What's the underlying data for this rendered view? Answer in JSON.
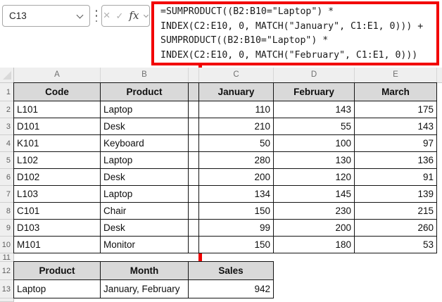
{
  "name_box": {
    "cell_ref": "C13"
  },
  "formula_bar": {
    "cancel_label": "×",
    "enter_label": "✓",
    "fx_label": "fx"
  },
  "formula_box": {
    "lines": [
      "=SUMPRODUCT((B2:B10=\"Laptop\") *",
      "INDEX(C2:E10, 0, MATCH(\"January\", C1:E1, 0))) +",
      "SUMPRODUCT((B2:B10=\"Laptop\") *",
      "INDEX(C2:E10, 0, MATCH(\"February\", C1:E1, 0)))"
    ]
  },
  "sheet": {
    "column_letters": [
      "A",
      "B",
      "C",
      "D",
      "E"
    ],
    "row_numbers": [
      "1",
      "2",
      "3",
      "4",
      "5",
      "6",
      "7",
      "8",
      "9",
      "10",
      "11",
      "12",
      "13"
    ],
    "top_table": {
      "headers": [
        "Code",
        "Product",
        "January",
        "February",
        "March"
      ],
      "rows": [
        [
          "L101",
          "Laptop",
          "110",
          "143",
          "175"
        ],
        [
          "D101",
          "Desk",
          "210",
          "55",
          "143"
        ],
        [
          "K101",
          "Keyboard",
          "50",
          "100",
          "97"
        ],
        [
          "L102",
          "Laptop",
          "280",
          "130",
          "136"
        ],
        [
          "D102",
          "Desk",
          "200",
          "120",
          "91"
        ],
        [
          "L103",
          "Laptop",
          "134",
          "145",
          "139"
        ],
        [
          "C101",
          "Chair",
          "150",
          "230",
          "215"
        ],
        [
          "D103",
          "Desk",
          "99",
          "200",
          "260"
        ],
        [
          "M101",
          "Monitor",
          "150",
          "180",
          "53"
        ]
      ]
    },
    "bottom_table": {
      "headers": [
        "Product",
        "Month",
        "Sales"
      ],
      "rows": [
        [
          "Laptop",
          "January, February",
          "942"
        ]
      ]
    }
  },
  "colors": {
    "accent_red": "#F20000",
    "header_fill": "#D9D9D9",
    "chrome_fill": "#EFEFEF",
    "grid_black": "#141414"
  }
}
